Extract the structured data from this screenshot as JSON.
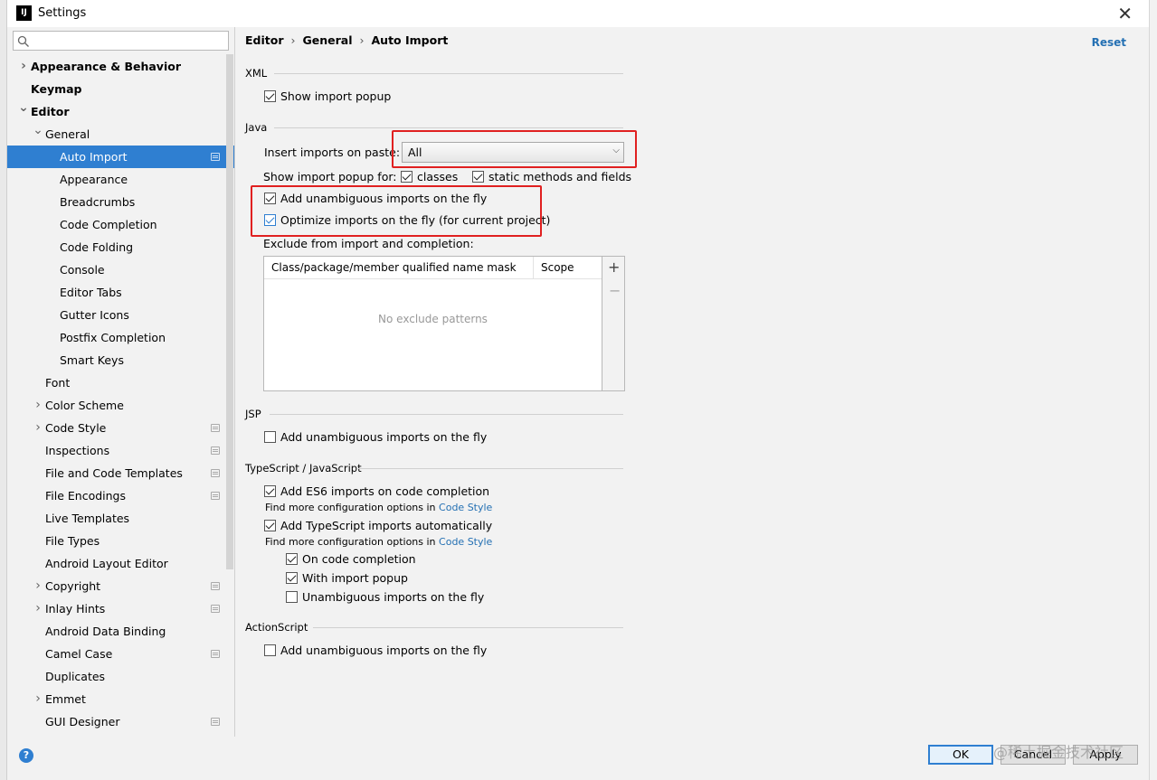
{
  "window": {
    "app_logo": "IJ",
    "title": "Settings"
  },
  "sidebar": {
    "search_placeholder": "",
    "items": [
      {
        "label": "Appearance & Behavior",
        "level": 0,
        "expander": "collapsed",
        "bold": true,
        "project": false
      },
      {
        "label": "Keymap",
        "level": 0,
        "expander": "none",
        "bold": true,
        "project": false
      },
      {
        "label": "Editor",
        "level": 0,
        "expander": "expanded",
        "bold": true,
        "project": false
      },
      {
        "label": "General",
        "level": 1,
        "expander": "expanded",
        "bold": false,
        "project": false
      },
      {
        "label": "Auto Import",
        "level": 2,
        "expander": "none",
        "bold": false,
        "project": true,
        "selected": true
      },
      {
        "label": "Appearance",
        "level": 2,
        "expander": "none",
        "bold": false,
        "project": false
      },
      {
        "label": "Breadcrumbs",
        "level": 2,
        "expander": "none",
        "bold": false,
        "project": false
      },
      {
        "label": "Code Completion",
        "level": 2,
        "expander": "none",
        "bold": false,
        "project": false
      },
      {
        "label": "Code Folding",
        "level": 2,
        "expander": "none",
        "bold": false,
        "project": false
      },
      {
        "label": "Console",
        "level": 2,
        "expander": "none",
        "bold": false,
        "project": false
      },
      {
        "label": "Editor Tabs",
        "level": 2,
        "expander": "none",
        "bold": false,
        "project": false
      },
      {
        "label": "Gutter Icons",
        "level": 2,
        "expander": "none",
        "bold": false,
        "project": false
      },
      {
        "label": "Postfix Completion",
        "level": 2,
        "expander": "none",
        "bold": false,
        "project": false
      },
      {
        "label": "Smart Keys",
        "level": 2,
        "expander": "none",
        "bold": false,
        "project": false
      },
      {
        "label": "Font",
        "level": 1,
        "expander": "none",
        "bold": false,
        "project": false
      },
      {
        "label": "Color Scheme",
        "level": 1,
        "expander": "collapsed",
        "bold": false,
        "project": false
      },
      {
        "label": "Code Style",
        "level": 1,
        "expander": "collapsed",
        "bold": false,
        "project": true
      },
      {
        "label": "Inspections",
        "level": 1,
        "expander": "none",
        "bold": false,
        "project": true
      },
      {
        "label": "File and Code Templates",
        "level": 1,
        "expander": "none",
        "bold": false,
        "project": true
      },
      {
        "label": "File Encodings",
        "level": 1,
        "expander": "none",
        "bold": false,
        "project": true
      },
      {
        "label": "Live Templates",
        "level": 1,
        "expander": "none",
        "bold": false,
        "project": false
      },
      {
        "label": "File Types",
        "level": 1,
        "expander": "none",
        "bold": false,
        "project": false
      },
      {
        "label": "Android Layout Editor",
        "level": 1,
        "expander": "none",
        "bold": false,
        "project": false
      },
      {
        "label": "Copyright",
        "level": 1,
        "expander": "collapsed",
        "bold": false,
        "project": true
      },
      {
        "label": "Inlay Hints",
        "level": 1,
        "expander": "collapsed",
        "bold": false,
        "project": true
      },
      {
        "label": "Android Data Binding",
        "level": 1,
        "expander": "none",
        "bold": false,
        "project": false
      },
      {
        "label": "Camel Case",
        "level": 1,
        "expander": "none",
        "bold": false,
        "project": true
      },
      {
        "label": "Duplicates",
        "level": 1,
        "expander": "none",
        "bold": false,
        "project": false
      },
      {
        "label": "Emmet",
        "level": 1,
        "expander": "collapsed",
        "bold": false,
        "project": false
      },
      {
        "label": "GUI Designer",
        "level": 1,
        "expander": "none",
        "bold": false,
        "project": true
      }
    ]
  },
  "header": {
    "crumb1": "Editor",
    "crumb2": "General",
    "crumb3": "Auto Import",
    "separator": "›",
    "reset": "Reset"
  },
  "xml": {
    "title": "XML",
    "show_import_popup": {
      "label": "Show import popup",
      "checked": true
    }
  },
  "java": {
    "title": "Java",
    "insert_label": "Insert imports on paste:",
    "insert_value": "All",
    "popup_for_label": "Show import popup for:",
    "classes": {
      "label": "classes",
      "checked": true
    },
    "static_methods": {
      "label": "static methods and fields",
      "checked": true
    },
    "add_unambiguous": {
      "label": "Add unambiguous imports on the fly",
      "checked": true
    },
    "optimize_imports": {
      "label": "Optimize imports on the fly (for current project)",
      "checked": true
    },
    "exclude_label": "Exclude from import and completion:",
    "table": {
      "col1": "Class/package/member qualified name mask",
      "col2": "Scope",
      "empty_text": "No exclude patterns"
    }
  },
  "jsp": {
    "title": "JSP",
    "add_unambiguous": {
      "label": "Add unambiguous imports on the fly",
      "checked": false
    }
  },
  "ts": {
    "title": "TypeScript / JavaScript",
    "es6": {
      "label": "Add ES6 imports on code completion",
      "checked": true
    },
    "find_more_1": "Find more configuration options in ",
    "code_style_1": "Code Style",
    "ts_auto": {
      "label": "Add TypeScript imports automatically",
      "checked": true
    },
    "find_more_2": "Find more configuration options in ",
    "code_style_2": "Code Style",
    "on_completion": {
      "label": "On code completion",
      "checked": true
    },
    "with_popup": {
      "label": "With import popup",
      "checked": true
    },
    "unambiguous": {
      "label": "Unambiguous imports on the fly",
      "checked": false
    }
  },
  "actionscript": {
    "title": "ActionScript",
    "add_unambiguous": {
      "label": "Add unambiguous imports on the fly",
      "checked": false
    }
  },
  "footer": {
    "help": "?",
    "ok": "OK",
    "cancel": "Cancel",
    "apply": "Apply",
    "watermark": "@稀土掘金技术社区"
  },
  "colors": {
    "selection": "#2f7fd1",
    "link": "#2470b3",
    "highlight_box": "#e02020"
  }
}
